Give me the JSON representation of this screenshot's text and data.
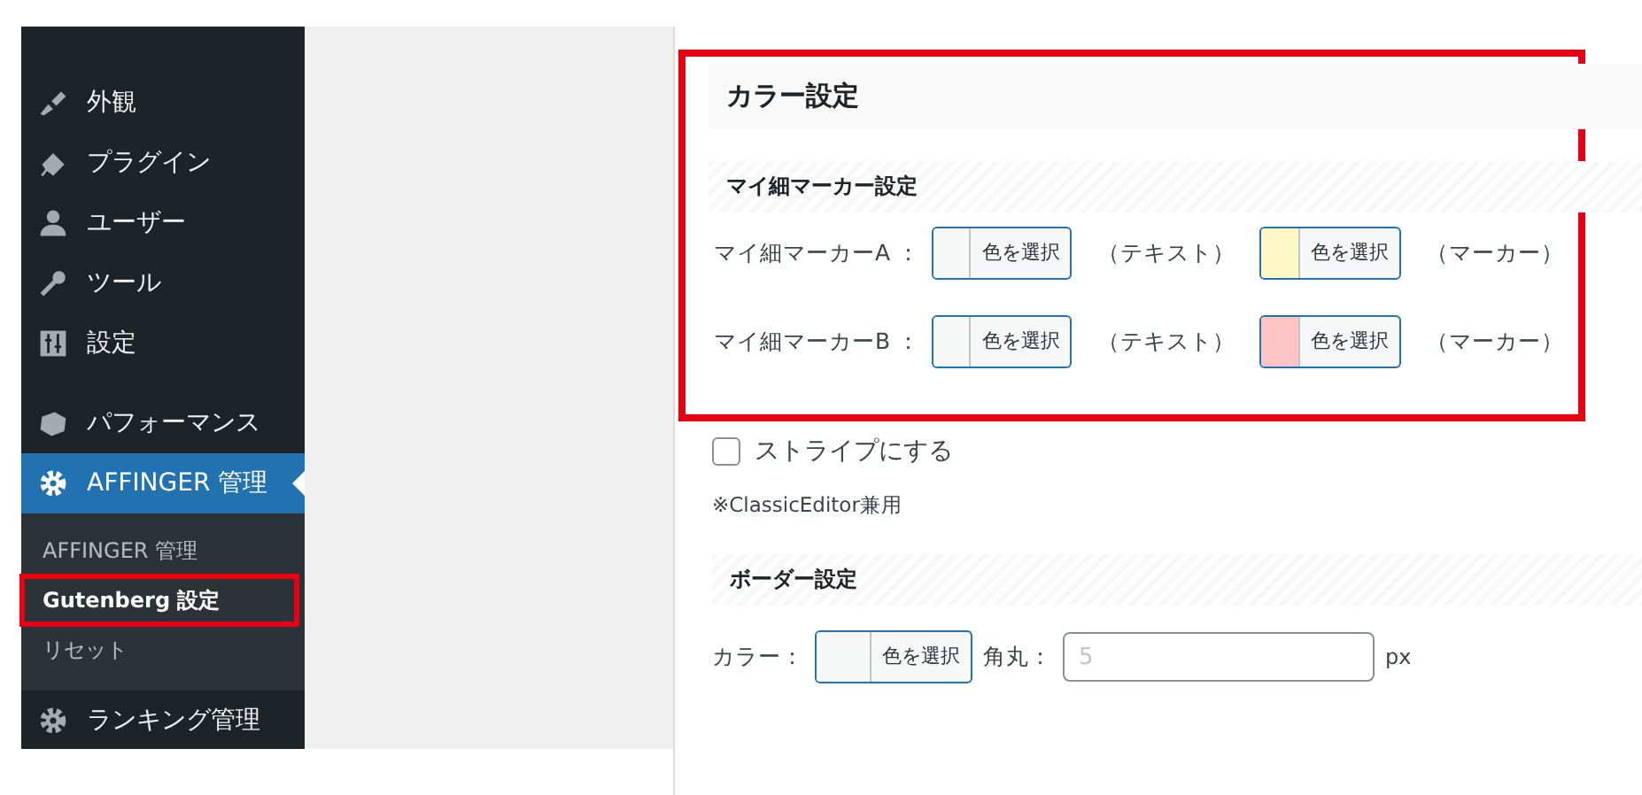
{
  "sidebar": {
    "items": [
      {
        "label": "外観",
        "current": false
      },
      {
        "label": "プラグイン",
        "current": false
      },
      {
        "label": "ユーザー",
        "current": false
      },
      {
        "label": "ツール",
        "current": false
      },
      {
        "label": "設定",
        "current": false
      },
      {
        "label": "パフォーマンス",
        "current": false
      },
      {
        "label": "AFFINGER 管理",
        "current": true,
        "children": [
          {
            "label": "AFFINGER 管理",
            "selected": false,
            "highlighted": false
          },
          {
            "label": "Gutenberg 設定",
            "selected": true,
            "highlighted": true
          },
          {
            "label": "リセット",
            "selected": false,
            "highlighted": false
          }
        ]
      },
      {
        "label": "ランキング管理",
        "current": false
      }
    ]
  },
  "color_section": {
    "title": "カラー設定",
    "highlighted": true,
    "subheading": "マイ細マーカー設定",
    "rows": [
      {
        "label": "マイ細マーカーA ：",
        "pickers": [
          {
            "color": "#f6f7f7",
            "button": "色を選択",
            "suffix": "（テキスト）"
          },
          {
            "color": "#fff8c5",
            "button": "色を選択",
            "suffix": "（マーカー）"
          }
        ]
      },
      {
        "label": "マイ細マーカーB ：",
        "pickers": [
          {
            "color": "#f6f7f7",
            "button": "色を選択",
            "suffix": "（テキスト）"
          },
          {
            "color": "#ffc5c5",
            "button": "色を選択",
            "suffix": "（マーカー）"
          }
        ]
      }
    ]
  },
  "stripe_checkbox": {
    "label": "ストライプにする",
    "checked": false
  },
  "note": "※ClassicEditor兼用",
  "border_section": {
    "subheading": "ボーダー設定",
    "color_label": "カラー：",
    "picker": {
      "color": "#f6f7f7",
      "button": "色を選択"
    },
    "radius_label": "角丸：",
    "radius_placeholder": "5",
    "unit": "px"
  }
}
